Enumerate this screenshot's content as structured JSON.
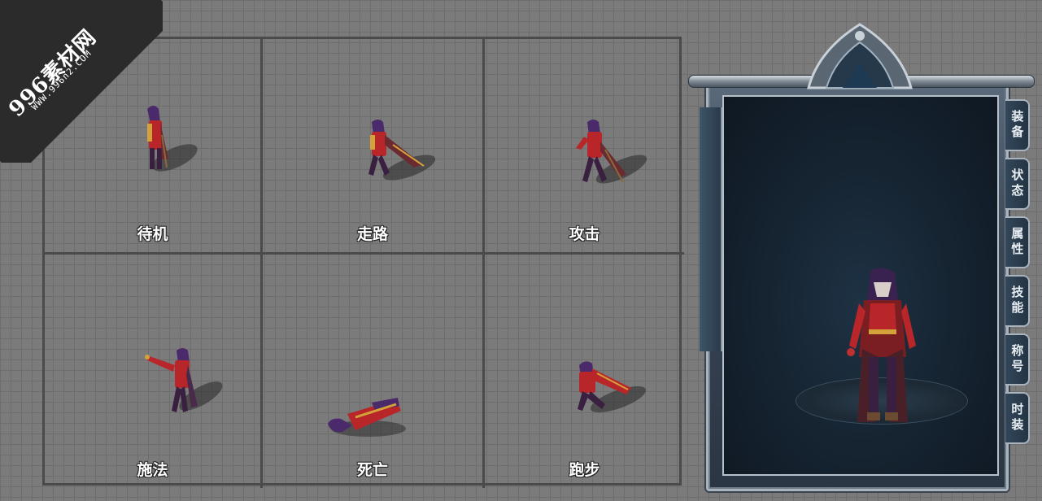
{
  "watermark": {
    "main": "996素材网",
    "sub": "WWW.996n2.COM"
  },
  "animations": [
    {
      "label": "待机"
    },
    {
      "label": "走路"
    },
    {
      "label": "攻击"
    },
    {
      "label": "施法"
    },
    {
      "label": "死亡"
    },
    {
      "label": "跑步"
    }
  ],
  "character_panel": {
    "tabs": [
      "装备",
      "状态",
      "属性",
      "技能",
      "称号",
      "时装"
    ]
  },
  "colors": {
    "background": "#7b7b7b",
    "grid_line": "#4a4a4a",
    "panel_frame": "#a8b3bd",
    "panel_bg": "#15222f",
    "robe_purple": "#4a2a6a",
    "robe_red": "#b8262a",
    "gold": "#d4a23a"
  }
}
